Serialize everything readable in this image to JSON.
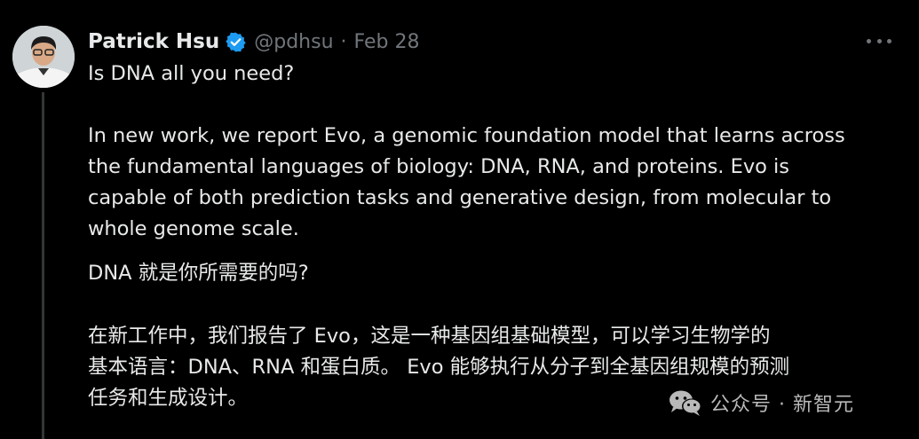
{
  "author": {
    "name": "Patrick Hsu",
    "handle": "@pdhsu",
    "separator": "·",
    "date": "Feb 28"
  },
  "tweet": {
    "lines_en": [
      "Is DNA all you need?",
      "In new work, we report Evo, a genomic foundation model that learns across",
      "the fundamental languages of biology: DNA, RNA, and proteins. Evo is",
      "capable of both prediction tasks and generative design, from molecular to",
      "whole genome scale."
    ],
    "lines_zh": [
      "DNA 就是你所需要的吗?",
      "在新工作中，我们报告了 Evo，这是一种基因组基础模型，可以学习生物学的",
      "基本语言：DNA、RNA 和蛋白质。 Evo 能够执行从分子到全基因组规模的预测",
      "任务和生成设计。"
    ]
  },
  "watermark": {
    "text": "公众号 · 新智元",
    "icon": "wechat-icon"
  },
  "icons": {
    "verified": "verified-badge-icon",
    "more": "more-options-icon"
  },
  "colors": {
    "background": "#000000",
    "primary_text": "#e7e9ea",
    "secondary_text": "#71767b",
    "verified_blue": "#1d9bf0"
  }
}
